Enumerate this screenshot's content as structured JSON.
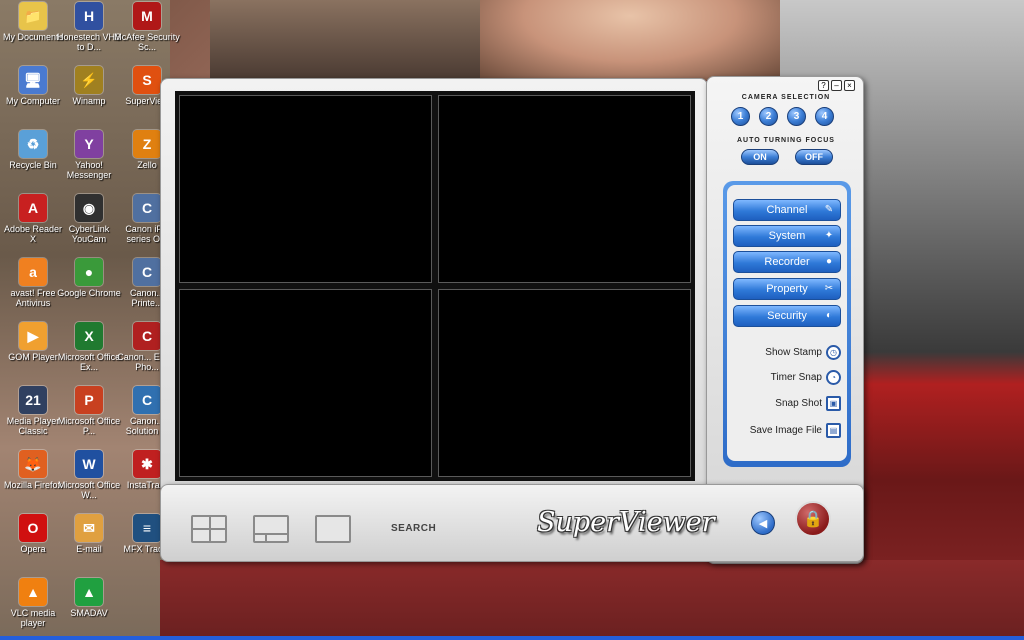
{
  "desktop": {
    "icons": [
      {
        "label": "My Documents",
        "glyph": "📁",
        "color": "#e8c44a"
      },
      {
        "label": "My Computer",
        "glyph": "🖥",
        "color": "#4a7ad0"
      },
      {
        "label": "Recycle Bin",
        "glyph": "♻",
        "color": "#5aa0d8"
      },
      {
        "label": "Adobe Reader X",
        "glyph": "A",
        "color": "#c82020"
      },
      {
        "label": "avast! Free Antivirus",
        "glyph": "a",
        "color": "#f08020"
      },
      {
        "label": "GOM Player",
        "glyph": "▶",
        "color": "#f0a030"
      },
      {
        "label": "Media Player Classic",
        "glyph": "21",
        "color": "#304060"
      },
      {
        "label": "Mozilla Firefox",
        "glyph": "🦊",
        "color": "#e06020"
      },
      {
        "label": "Opera",
        "glyph": "O",
        "color": "#d01010"
      },
      {
        "label": "VLC media player",
        "glyph": "▲",
        "color": "#f08010"
      },
      {
        "label": "Honestech VHS to D...",
        "glyph": "H",
        "color": "#3050a0"
      },
      {
        "label": "Winamp",
        "glyph": "⚡",
        "color": "#a08020"
      },
      {
        "label": "Yahoo! Messenger",
        "glyph": "Y",
        "color": "#8040a0"
      },
      {
        "label": "CyberLink YouCam",
        "glyph": "◉",
        "color": "#303030"
      },
      {
        "label": "Google Chrome",
        "glyph": "●",
        "color": "#3a9a3a"
      },
      {
        "label": "Microsoft Office Ex...",
        "glyph": "X",
        "color": "#207a30"
      },
      {
        "label": "Microsoft Office P...",
        "glyph": "P",
        "color": "#c84020"
      },
      {
        "label": "Microsoft Office W...",
        "glyph": "W",
        "color": "#2050a0"
      },
      {
        "label": "E-mail",
        "glyph": "✉",
        "color": "#e0a040"
      },
      {
        "label": "SMADAV",
        "glyph": "▲",
        "color": "#20a040"
      },
      {
        "label": "McAfee Security Sc...",
        "glyph": "M",
        "color": "#b01818"
      },
      {
        "label": "SuperView",
        "glyph": "S",
        "color": "#e05010"
      },
      {
        "label": "Zello",
        "glyph": "Z",
        "color": "#e08010"
      },
      {
        "label": "Canon iP... series O...",
        "glyph": "C",
        "color": "#5070a0"
      },
      {
        "label": "Canon... Printe...",
        "glyph": "C",
        "color": "#5070a0"
      },
      {
        "label": "Canon... Easy-Pho...",
        "glyph": "C",
        "color": "#b02020"
      },
      {
        "label": "Canon... Solution ...",
        "glyph": "C",
        "color": "#3070b0"
      },
      {
        "label": "InstaTra...",
        "glyph": "✱",
        "color": "#c02020"
      },
      {
        "label": "MFX Trad...",
        "glyph": "≡",
        "color": "#205080"
      }
    ]
  },
  "window": {
    "help": "?",
    "minimize": "–",
    "close": "×"
  },
  "side": {
    "camera_selection_title": "CAMERA SELECTION",
    "cameras": [
      "1",
      "2",
      "3",
      "4"
    ],
    "auto_focus_title": "AUTO TURNING FOCUS",
    "focus_on": "ON",
    "focus_off": "OFF",
    "menu": [
      {
        "label": "Channel",
        "icon": "✎"
      },
      {
        "label": "System",
        "icon": "✦"
      },
      {
        "label": "Recorder",
        "icon": "●"
      },
      {
        "label": "Property",
        "icon": "✂"
      },
      {
        "label": "Security",
        "icon": "◐"
      }
    ],
    "actions": [
      {
        "label": "Show Stamp",
        "icon": "◷"
      },
      {
        "label": "Timer Snap",
        "icon": "◔"
      },
      {
        "label": "Snap Shot",
        "icon": "▣"
      },
      {
        "label": "Save Image File",
        "icon": "▤"
      }
    ]
  },
  "bottom": {
    "search_label": "SEARCH",
    "logo": "SuperViewer",
    "speaker_icon": "◀",
    "lock_icon": "🔒"
  }
}
